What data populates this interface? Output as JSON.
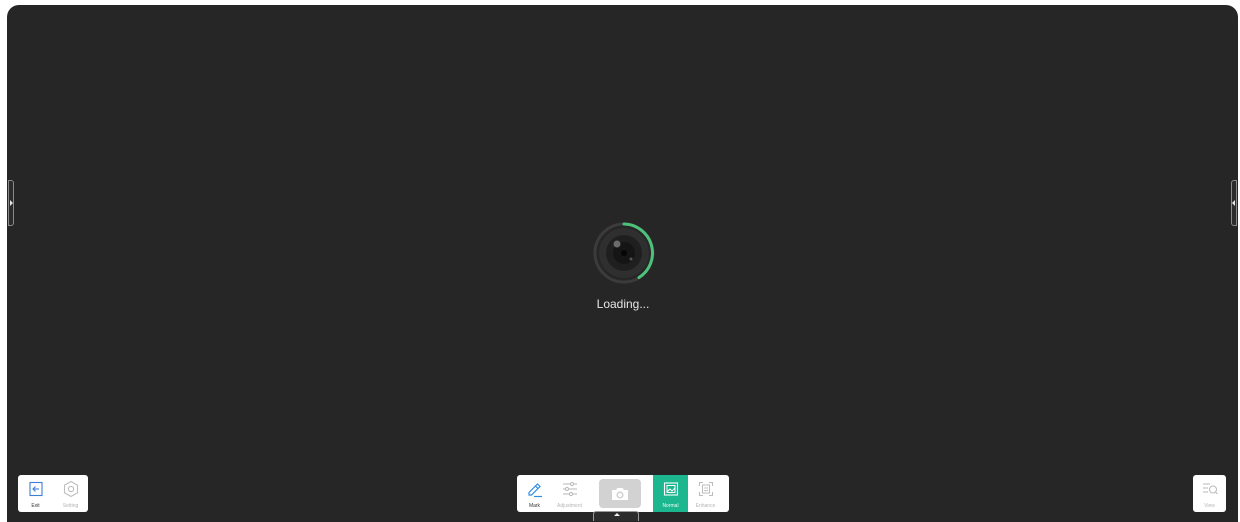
{
  "status": {
    "loading_text": "Loading..."
  },
  "left_toolbar": {
    "exit_label": "Exit",
    "setting_label": "Setting"
  },
  "center_toolbar": {
    "mark_label": "Mark",
    "adjustment_label": "Adjustment",
    "normal_label": "Normal",
    "enhance_label": "Enhance",
    "active_mode": "Normal"
  },
  "right_toolbar": {
    "view_label": "View"
  },
  "icons": [
    "exit-icon",
    "gear-icon",
    "pencil-icon",
    "sliders-icon",
    "camera-icon",
    "image-icon",
    "enhance-icon",
    "view-icon"
  ],
  "colors": {
    "background": "#262626",
    "accent": "#1cb68f",
    "loader_ring": "#4cc27a"
  }
}
